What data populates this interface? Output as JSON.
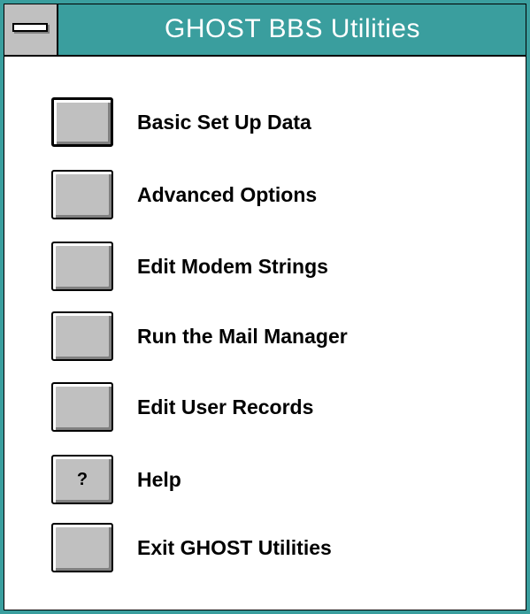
{
  "window": {
    "title": "GHOST BBS Utilities",
    "title_bar_color": "#3a9e9e"
  },
  "system_menu": {
    "icon": "system-menu-icon"
  },
  "menu": {
    "items": [
      {
        "label": "Basic Set Up Data",
        "button_text": "",
        "focused": true
      },
      {
        "label": "Advanced Options",
        "button_text": ""
      },
      {
        "label": "Edit Modem Strings",
        "button_text": ""
      },
      {
        "label": "Run the Mail Manager",
        "button_text": ""
      },
      {
        "label": "Edit User Records",
        "button_text": ""
      },
      {
        "label": "Help",
        "button_text": "?"
      },
      {
        "label": "Exit GHOST Utilities",
        "button_text": ""
      }
    ]
  }
}
